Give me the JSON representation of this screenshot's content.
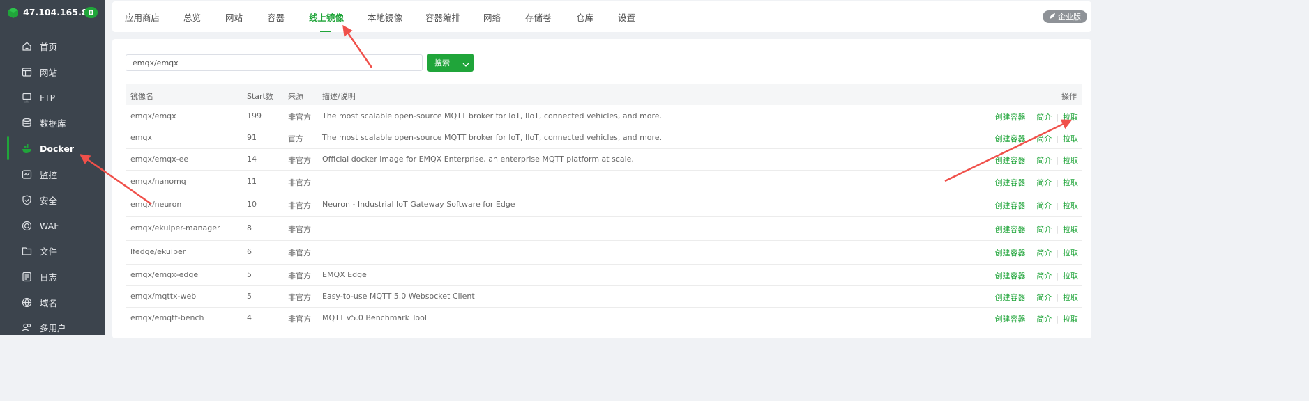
{
  "host": {
    "ip": "47.104.165.8",
    "badge": "0"
  },
  "sidebar": {
    "items": [
      {
        "label": "首页",
        "icon": "home-icon"
      },
      {
        "label": "网站",
        "icon": "website-icon"
      },
      {
        "label": "FTP",
        "icon": "ftp-icon"
      },
      {
        "label": "数据库",
        "icon": "database-icon"
      },
      {
        "label": "Docker",
        "icon": "docker-icon",
        "active": true
      },
      {
        "label": "监控",
        "icon": "monitor-icon"
      },
      {
        "label": "安全",
        "icon": "security-shield-icon"
      },
      {
        "label": "WAF",
        "icon": "waf-icon"
      },
      {
        "label": "文件",
        "icon": "folder-icon"
      },
      {
        "label": "日志",
        "icon": "log-icon"
      },
      {
        "label": "域名",
        "icon": "domain-globe-icon"
      },
      {
        "label": "多用户",
        "icon": "multi-user-icon"
      }
    ]
  },
  "tabs": [
    "应用商店",
    "总览",
    "网站",
    "容器",
    "线上镜像",
    "本地镜像",
    "容器编排",
    "网络",
    "存储卷",
    "仓库",
    "设置"
  ],
  "active_tab": "线上镜像",
  "enterprise_label": "企业版",
  "search": {
    "value": "emqx/emqx",
    "button": "搜索"
  },
  "table": {
    "headers": {
      "name": "镜像名",
      "stars": "Start数",
      "source": "来源",
      "desc": "描述/说明",
      "ops": "操作"
    },
    "ops": {
      "create": "创建容器",
      "intro": "简介",
      "pull": "拉取"
    },
    "rows": [
      {
        "name": "emqx/emqx",
        "stars": "199",
        "source": "非官方",
        "desc": "The most scalable open-source MQTT broker for IoT, IIoT, connected vehicles, and more."
      },
      {
        "name": "emqx",
        "stars": "91",
        "source": "官方",
        "desc": "The most scalable open-source MQTT broker for IoT, IIoT, connected vehicles, and more."
      },
      {
        "name": "emqx/emqx-ee",
        "stars": "14",
        "source": "非官方",
        "desc": "Official docker image for EMQX Enterprise, an enterprise MQTT platform at scale."
      },
      {
        "name": "emqx/nanomq",
        "stars": "11",
        "source": "非官方",
        "desc": ""
      },
      {
        "name": "emqx/neuron",
        "stars": "10",
        "source": "非官方",
        "desc": "Neuron - Industrial IoT Gateway Software for Edge"
      },
      {
        "name": "emqx/ekuiper-manager",
        "stars": "8",
        "source": "非官方",
        "desc": ""
      },
      {
        "name": "lfedge/ekuiper",
        "stars": "6",
        "source": "非官方",
        "desc": ""
      },
      {
        "name": "emqx/emqx-edge",
        "stars": "5",
        "source": "非官方",
        "desc": "EMQX Edge"
      },
      {
        "name": "emqx/mqttx-web",
        "stars": "5",
        "source": "非官方",
        "desc": "Easy-to-use MQTT 5.0 Websocket Client"
      },
      {
        "name": "emqx/emqtt-bench",
        "stars": "4",
        "source": "非官方",
        "desc": "MQTT v5.0 Benchmark Tool"
      }
    ]
  },
  "colors": {
    "accent": "#20a53a",
    "sidebar_bg": "#3c444d",
    "arrow": "#f0504a"
  }
}
